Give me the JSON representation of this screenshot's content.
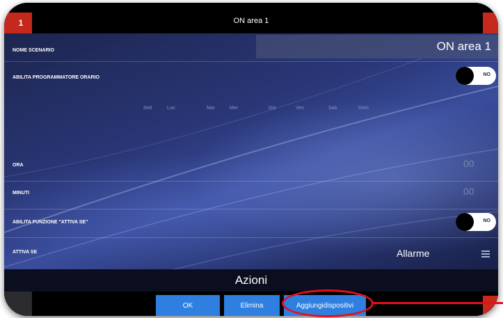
{
  "window": {
    "title": "ON area 1",
    "corner_left_label": "1"
  },
  "form": {
    "nome_scenario_label": "NOME SCENARIO",
    "nome_scenario_value": "ON area 1",
    "abilita_programmatore_label": "ABILITA PROGRAMMATORE ORARIO",
    "abilita_programmatore_state": "NO",
    "days": [
      "Sett",
      "Lun",
      "Mar",
      "Mer",
      "Gio",
      "Ven",
      "Sab",
      "Dom"
    ],
    "ora_label": "ORA",
    "ora_value": "00",
    "minuti_label": "MINUTI",
    "minuti_value": "00",
    "abilita_attiva_se_label": "ABILITA FUNZIONE \"ATTIVA SE\"",
    "abilita_attiva_se_state": "NO",
    "attiva_se_label": "ATTIVA SE",
    "attiva_se_value": "Allarme"
  },
  "azioni": {
    "label": "Azioni"
  },
  "footer": {
    "ok_label": "OK",
    "elimina_label": "Elimina",
    "aggiungi_line1": "Aggiungi",
    "aggiungi_line2": "dispositivi"
  },
  "colors": {
    "accent_red": "#c5281c",
    "button_blue": "#2e7fe0",
    "annotation_red": "#e3101c",
    "background_blue": "#2a3778"
  },
  "icons": {
    "menu": "hamburger-menu-icon",
    "corner_left": "app-logo-icon"
  }
}
